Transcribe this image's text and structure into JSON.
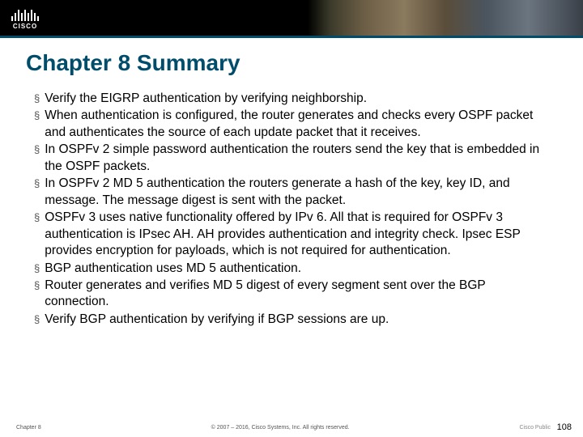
{
  "header": {
    "logo_text": "CISCO"
  },
  "title": "Chapter 8 Summary",
  "bullets": [
    "Verify the EIGRP authentication by verifying neighborship.",
    "When authentication is configured, the router generates and checks every OSPF packet and authenticates the source of each update packet that it receives.",
    "In OSPFv 2 simple password authentication the routers send the key that is embedded in the OSPF packets.",
    "In OSPFv 2 MD 5 authentication the routers generate a hash of the key, key ID, and message. The message digest is sent with the packet.",
    "OSPFv 3 uses native functionality offered by IPv 6. All that is required for OSPFv 3 authentication is IPsec AH. AH provides authentication and integrity check. Ipsec ESP provides encryption for payloads, which is not required for authentication.",
    "BGP authentication uses MD 5 authentication.",
    "Router generates and verifies MD 5 digest of every segment sent over the BGP connection.",
    "Verify BGP authentication by verifying if BGP sessions are up."
  ],
  "footer": {
    "left": "Chapter 8",
    "center": "© 2007 – 2016, Cisco Systems, Inc. All rights reserved.",
    "right": "Cisco Public",
    "page": "108"
  }
}
